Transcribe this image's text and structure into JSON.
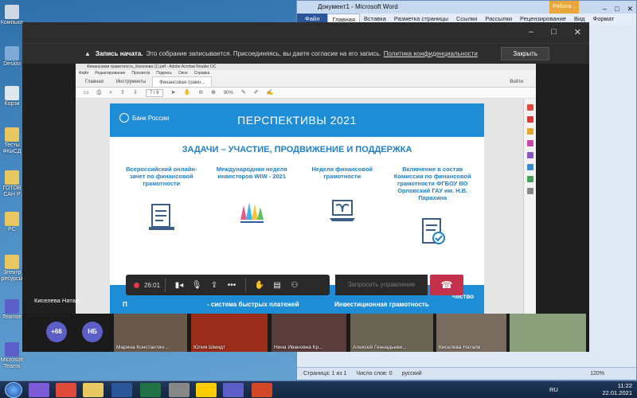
{
  "desktop": {
    "icons": [
      "Компьют",
      "Deskto",
      "Корзи",
      "Тесты ФКиСД",
      "ГОТОВ САН Р",
      "РС",
      "Электр ресурсы",
      "Teamse",
      "Microsoft Teams"
    ]
  },
  "word": {
    "title": "Документ1 - Microsoft Word",
    "badge": "Работа...",
    "menu": [
      "Файл",
      "Главная",
      "Вставка",
      "Разметка страницы",
      "Ссылки",
      "Рассылки",
      "Рецензирование",
      "Вид",
      "Формат"
    ],
    "status": {
      "page": "Страница: 1 из 1",
      "words": "Число слов: 0",
      "lang": "русский",
      "zoom": "120%"
    }
  },
  "teams": {
    "recording": {
      "bold": "Запись начата.",
      "text": "Это собрание записывается. Присоединяясь, вы даете согласие на его запись.",
      "link": "Политика конфиденциальности",
      "close": "Закрыть"
    },
    "acrobat": {
      "title": "Финансовая грамотность_Киселева (1).pdf - Adobe Acrobat Reader DC",
      "menu": [
        "Файл",
        "Редактирование",
        "Просмотр",
        "Подпись",
        "Окно",
        "Справка"
      ],
      "tabs": [
        "Главная",
        "Инструменты",
        "Финансовая грамо..."
      ],
      "login": "Войти",
      "page": "7 / 8",
      "zoom": "90%"
    },
    "slide": {
      "logo": "Банк России",
      "title": "ПЕРСПЕКТИВЫ 2021",
      "subtitle": "ЗАДАЧИ – УЧАСТИЕ, ПРОДВИЖЕНИЕ И ПОДДЕРЖКА",
      "columns": [
        "Всероссийский онлайн-зачет по финансовой грамотности",
        "Международная неделя инвесторов WIW - 2021",
        "Неделя финансовой грамотности",
        "Включение в состав Комиссии по финансовой грамотности ФГБОУ ВО Орловский ГАУ им. Н.В. Парахина"
      ],
      "bottom_left": "система быстрых платежей",
      "bottom_right": "Инвестиционная грамотность",
      "bottom_far": "чество",
      "bottom_start": "П"
    },
    "controls": {
      "timer": "26:01",
      "take_control": "Запросить управление"
    },
    "self_name": "Киселева Натал",
    "overflow": "+66",
    "initials": "НБ",
    "participants": [
      "Марина Константин...",
      "Юлия Шмидт",
      "Нина Ивановна Кр...",
      "Алексей Геннадьеви...",
      "Киселева Натали",
      ""
    ]
  },
  "taskbar": {
    "lang": "RU",
    "time": "11:22",
    "date": "22.01.2021"
  }
}
